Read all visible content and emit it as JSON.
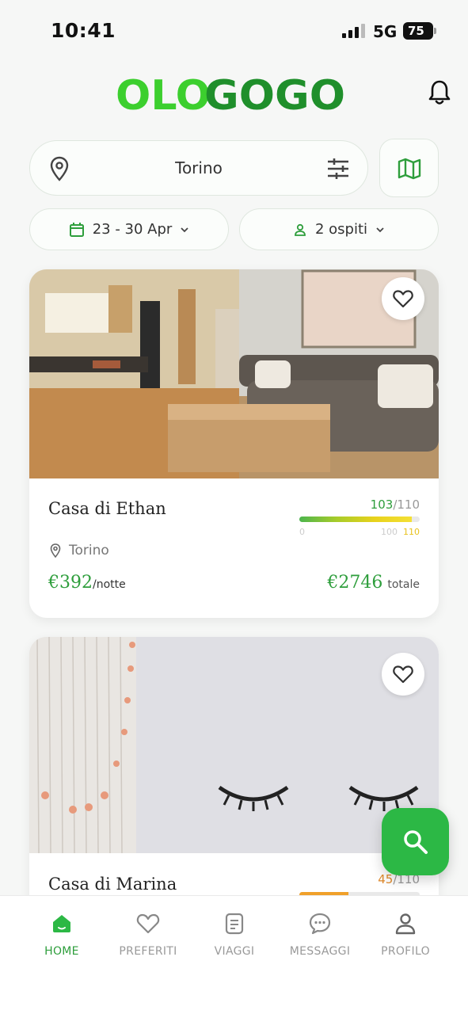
{
  "status_bar": {
    "time": "10:41",
    "network": "5G",
    "battery": "75"
  },
  "header": {
    "logo_text": "OLOGOGO",
    "logo_colors": [
      "#3ccf2e",
      "#1f8f2b"
    ]
  },
  "search": {
    "city": "Torino"
  },
  "filters": {
    "dates": "23 - 30 Apr",
    "guests": "2 ospiti"
  },
  "listings": [
    {
      "title": "Casa di Ethan",
      "score": "103",
      "score_max": "/110",
      "score_value": 103,
      "scale": [
        "0",
        "100",
        "110"
      ],
      "location": "Torino",
      "price": "€392",
      "price_unit": "/notte",
      "total": "€2746",
      "total_unit": "totale"
    },
    {
      "title": "Casa di Marina",
      "score": "45",
      "score_max": "/110",
      "score_value": 45
    }
  ],
  "nav": [
    {
      "label": "HOME",
      "icon": "home-icon",
      "active": true
    },
    {
      "label": "PREFERITI",
      "icon": "heart-icon",
      "active": false
    },
    {
      "label": "VIAGGI",
      "icon": "list-icon",
      "active": false
    },
    {
      "label": "MESSAGGI",
      "icon": "chat-icon",
      "active": false
    },
    {
      "label": "PROFILO",
      "icon": "user-icon",
      "active": false
    }
  ],
  "colors": {
    "accent": "#2e9e3c",
    "fab": "#2cb845",
    "warning": "#e08a2c"
  }
}
